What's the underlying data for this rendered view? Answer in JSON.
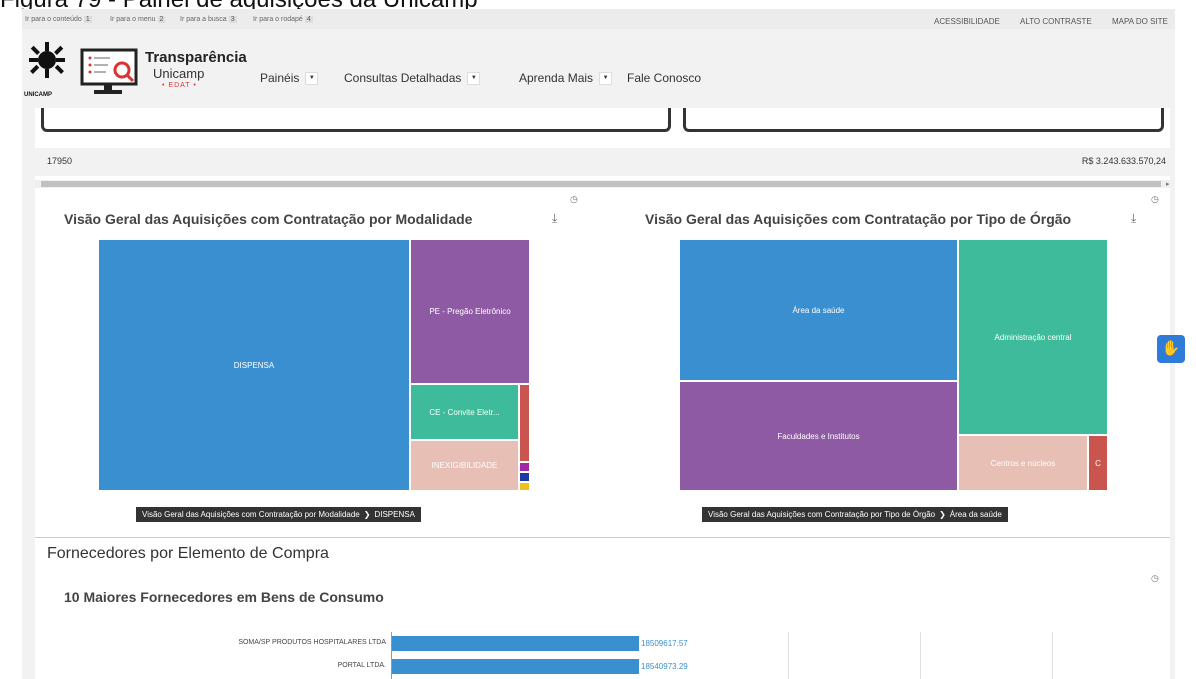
{
  "caption": "Figura 79 - Painel de aquisições da Unicamp",
  "skip_links": [
    {
      "label": "Ir para o conteúdo",
      "num": "1"
    },
    {
      "label": "Ir para o menu",
      "num": "2"
    },
    {
      "label": "Ir para a busca",
      "num": "3"
    },
    {
      "label": "Ir para o rodapé",
      "num": "4"
    }
  ],
  "utility_links": [
    "ACESSIBILIDADE",
    "ALTO CONTRASTE",
    "MAPA DO SITE"
  ],
  "logo": {
    "unicamp": "UNICAMP",
    "title": "Transparência",
    "subtitle": "Unicamp",
    "edat": "• EDAT •"
  },
  "nav": [
    "Painéis",
    "Consultas Detalhadas",
    "Aprenda Mais",
    "Fale Conosco"
  ],
  "summary": {
    "left": "17950",
    "right": "R$ 3.243.633.570,24"
  },
  "panel1": {
    "title": "Visão Geral das Aquisições com Contratação por Modalidade",
    "tiles": [
      "DISPENSA",
      "PE - Pregão Eletrônico",
      "CE - Convite Eletr...",
      "INEXIGIBILIDADE"
    ],
    "breadcrumb": [
      "Visão Geral das Aquisições com Contratação por Modalidade",
      "DISPENSA"
    ]
  },
  "panel2": {
    "title": "Visão Geral das Aquisições com Contratação por Tipo de Órgão",
    "tiles": [
      "Área da saúde",
      "Administração central",
      "Faculdades e Institutos",
      "Centros e núcleos",
      "C"
    ],
    "breadcrumb": [
      "Visão Geral das Aquisições com Contratação por Tipo de Órgão",
      "Área da saúde"
    ]
  },
  "section_title": "Fornecedores por Elemento de Compra",
  "chart_title": "10 Maiores Fornecedores em Bens de Consumo",
  "colors": {
    "blue": "#3a8fd0",
    "purple": "#8e5aa3",
    "teal": "#3dbb9a",
    "pink": "#e7bfb5",
    "red": "#c9554e"
  },
  "chart_data": {
    "type": "bar",
    "orientation": "horizontal",
    "categories": [
      "SOMA/SP PRODUTOS HOSPITALARES LTDA",
      "PORTAL LTDA."
    ],
    "values": [
      18509617.57,
      18540973.29
    ],
    "labels": [
      "18509617.57",
      "18540973.29"
    ]
  }
}
